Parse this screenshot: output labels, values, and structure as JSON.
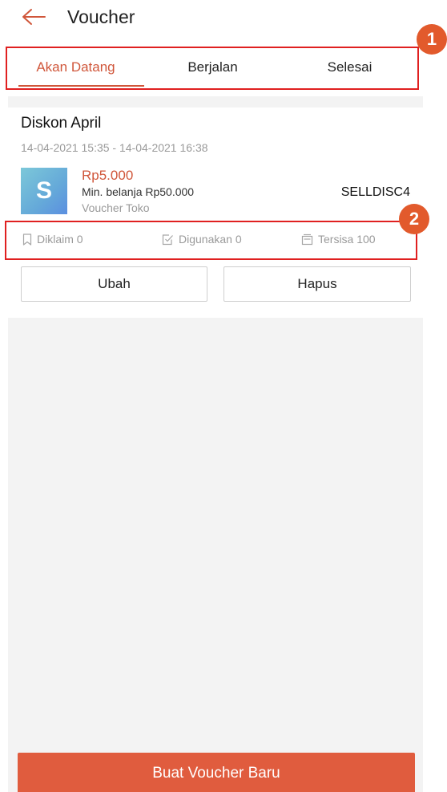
{
  "header": {
    "title": "Voucher",
    "back_icon": "arrow-left-icon"
  },
  "tabs": [
    {
      "label": "Akan Datang",
      "active": true
    },
    {
      "label": "Berjalan",
      "active": false
    },
    {
      "label": "Selesai",
      "active": false
    }
  ],
  "annotations": {
    "tabs_badge": "1",
    "stats_badge": "2"
  },
  "voucher": {
    "name": "Diskon April",
    "period": "14-04-2021 15:35 - 14-04-2021 16:38",
    "icon": "dollar-icon",
    "icon_glyph": "S",
    "amount": "Rp5.000",
    "min_purchase": "Min. belanja Rp50.000",
    "type": "Voucher Toko",
    "code": "SELLDISC4",
    "stats": {
      "claimed": "Diklaim 0",
      "used": "Digunakan 0",
      "remaining": "Tersisa 100"
    },
    "edit_label": "Ubah",
    "delete_label": "Hapus"
  },
  "footer": {
    "create_label": "Buat Voucher Baru"
  },
  "colors": {
    "accent": "#d0563a",
    "button": "#e05c3e",
    "annotation": "#e02020",
    "badge": "#e25a2c"
  }
}
